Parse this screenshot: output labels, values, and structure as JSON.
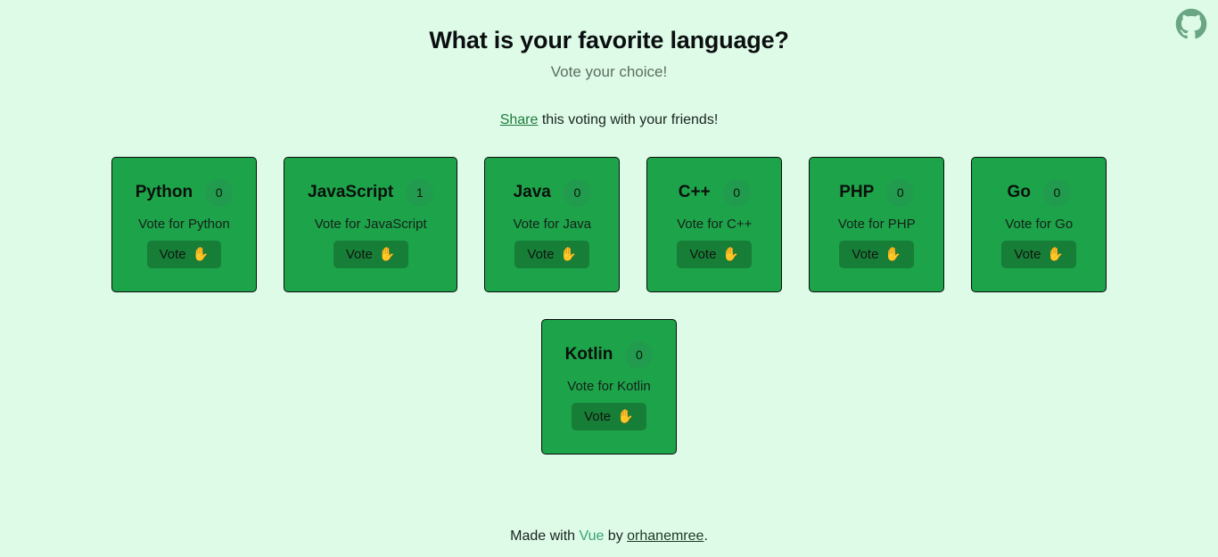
{
  "header": {
    "title": "What is your favorite language?",
    "subtitle": "Vote your choice!",
    "share_link": "Share",
    "share_rest": " this voting with your friends!"
  },
  "github": {
    "icon": "github-icon",
    "color": "#6aa683"
  },
  "theme": {
    "background": "#ddfbe6",
    "card": "#1da34a",
    "badge": "#219b4d",
    "button": "#177e38",
    "border": "#0b0d0c",
    "link": "#1f7a3e"
  },
  "cards": [
    {
      "name": "Python",
      "count": "0",
      "desc": "Vote for Python",
      "vote_label": "Vote",
      "emoji": "✋"
    },
    {
      "name": "JavaScript",
      "count": "1",
      "desc": "Vote for JavaScript",
      "vote_label": "Vote",
      "emoji": "✋"
    },
    {
      "name": "Java",
      "count": "0",
      "desc": "Vote for Java",
      "vote_label": "Vote",
      "emoji": "✋"
    },
    {
      "name": "C++",
      "count": "0",
      "desc": "Vote for C++",
      "vote_label": "Vote",
      "emoji": "✋"
    },
    {
      "name": "PHP",
      "count": "0",
      "desc": "Vote for PHP",
      "vote_label": "Vote",
      "emoji": "✋"
    },
    {
      "name": "Go",
      "count": "0",
      "desc": "Vote for Go",
      "vote_label": "Vote",
      "emoji": "✋"
    },
    {
      "name": "Kotlin",
      "count": "0",
      "desc": "Vote for Kotlin",
      "vote_label": "Vote",
      "emoji": "✋"
    }
  ],
  "footer": {
    "prefix": "Made with ",
    "framework": "Vue",
    "middle": " by ",
    "author": "orhanemree",
    "suffix": "."
  }
}
